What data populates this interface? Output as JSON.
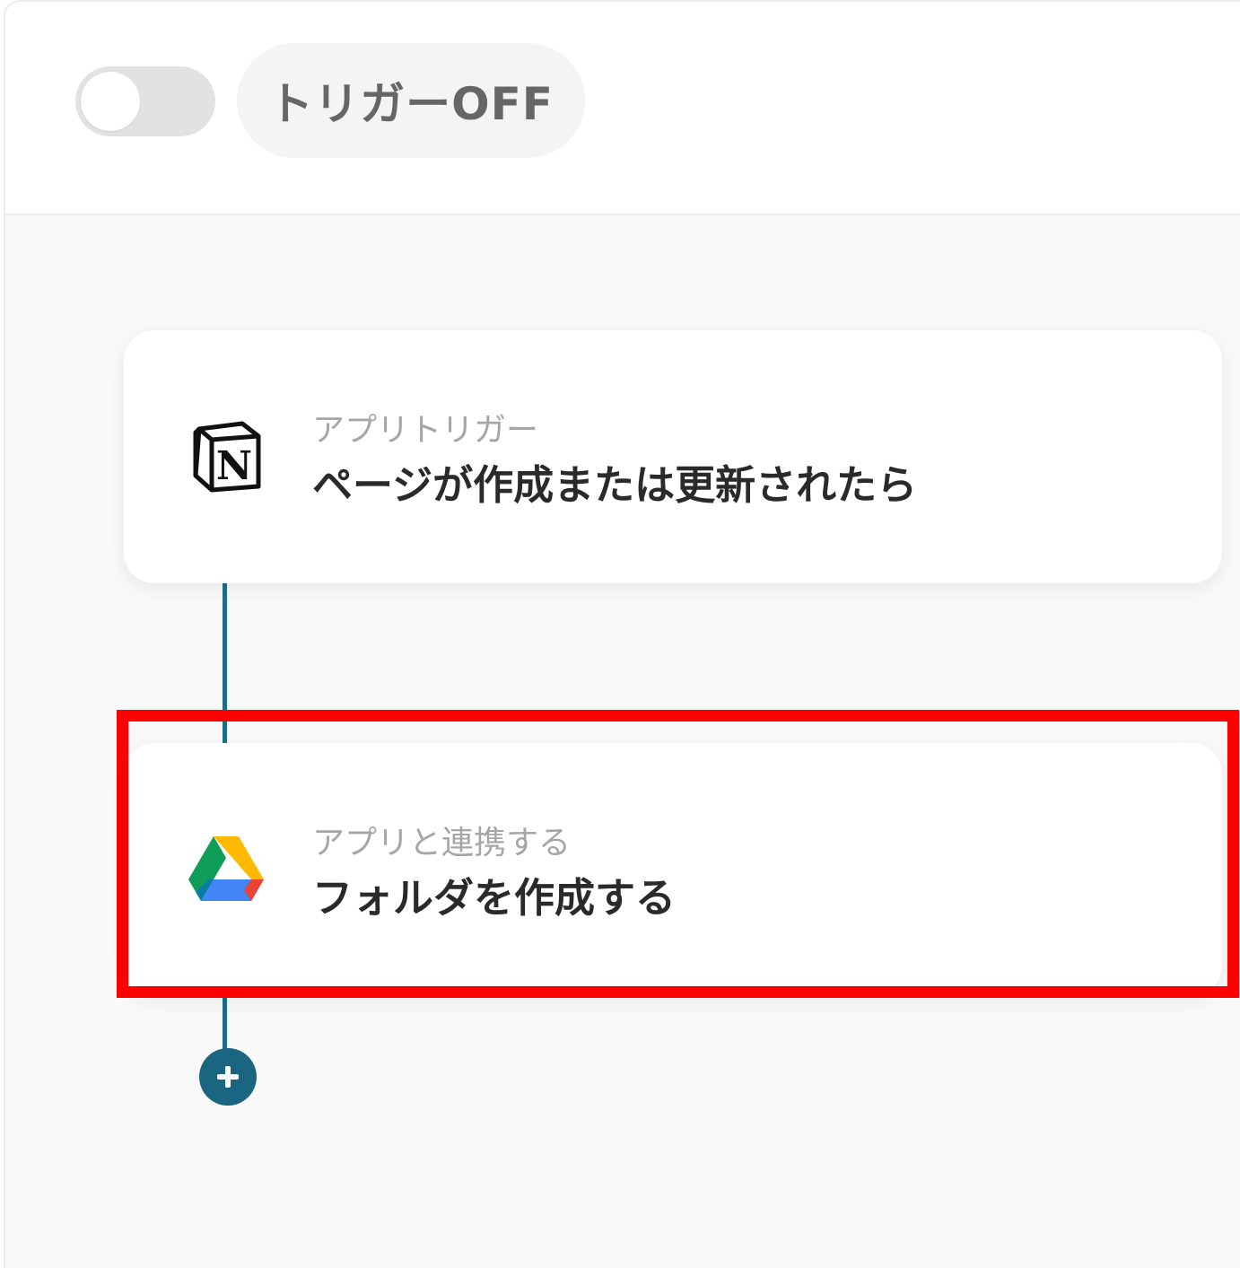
{
  "header": {
    "trigger_toggle": {
      "checked": false
    },
    "trigger_status": "トリガーOFF"
  },
  "flow": {
    "steps": [
      {
        "app": "Notion",
        "icon": "notion-icon",
        "label": "アプリトリガー",
        "title": "ページが作成または更新されたら"
      },
      {
        "app": "Google Drive",
        "icon": "google-drive-icon",
        "label": "アプリと連携する",
        "title": "フォルダを作成する",
        "highlighted": true
      }
    ],
    "add_step_icon": "plus-icon"
  },
  "colors": {
    "connector": "#1e6e86",
    "add_button": "#1a6680",
    "highlight": "#ff0000",
    "toggle_off": "#e2e2e2",
    "canvas_bg": "#f9f9f9"
  }
}
